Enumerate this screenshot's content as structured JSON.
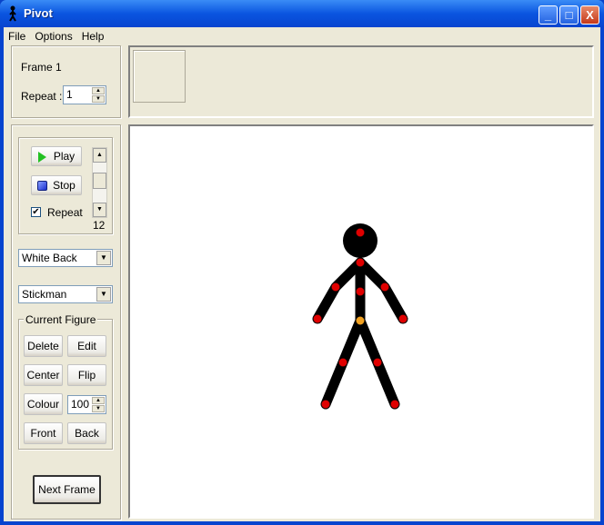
{
  "window": {
    "title": "Pivot",
    "min": "_",
    "max": "□",
    "close": "X"
  },
  "menu": [
    "File",
    "Options",
    "Help"
  ],
  "frame": {
    "label": "Frame 1",
    "repeat_label": "Repeat :",
    "repeat_value": "1"
  },
  "playback": {
    "play": "Play",
    "stop": "Stop",
    "repeat_label": "Repeat",
    "repeat_checked": true,
    "speed": "12"
  },
  "background_select": "White Back",
  "figure_type_select": "Stickman",
  "current_figure": {
    "title": "Current Figure",
    "delete": "Delete",
    "edit": "Edit",
    "center": "Center",
    "flip": "Flip",
    "colour": "Colour",
    "colour_value": "100",
    "front": "Front",
    "back": "Back"
  },
  "next_frame": "Next Frame",
  "colors": {
    "joint": "#e00000",
    "root_joint": "#f0a020",
    "figure": "#000000"
  }
}
